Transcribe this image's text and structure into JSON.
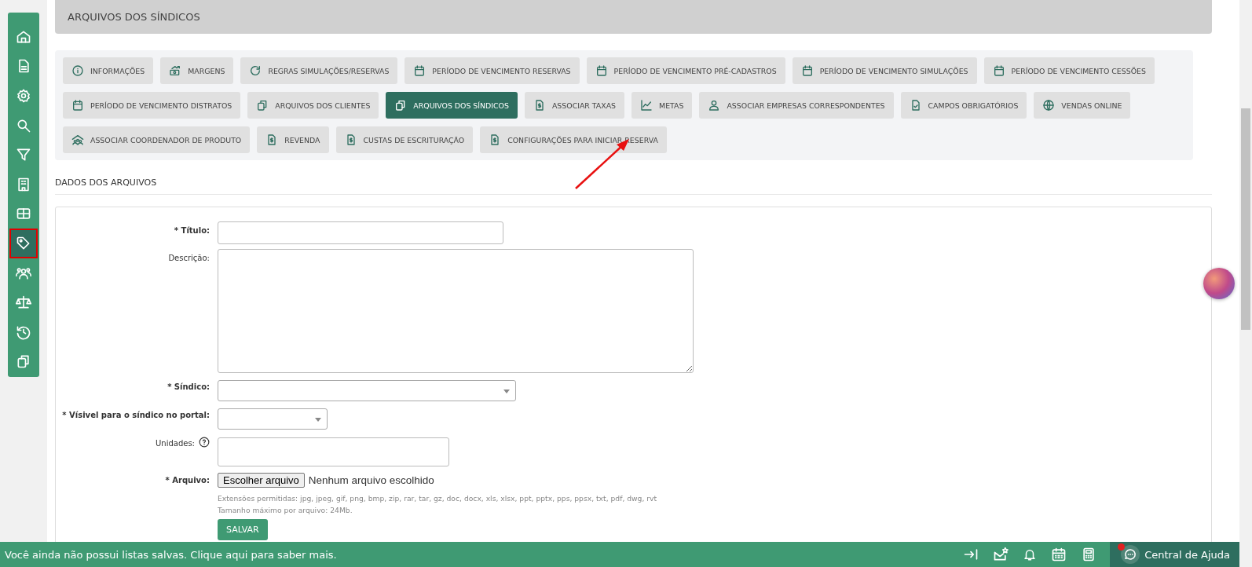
{
  "header": {
    "title": "ARQUIVOS DOS SÍNDICOS"
  },
  "sidebar": {
    "items": [
      {
        "selected": false
      },
      {
        "selected": false
      },
      {
        "selected": false
      },
      {
        "selected": false
      },
      {
        "selected": false
      },
      {
        "selected": false
      },
      {
        "selected": false
      },
      {
        "selected": true
      },
      {
        "selected": false
      },
      {
        "selected": false
      },
      {
        "selected": false
      },
      {
        "selected": false
      }
    ]
  },
  "tabs": [
    {
      "label": "INFORMAÇÕES",
      "selected": false
    },
    {
      "label": "MARGENS",
      "selected": false
    },
    {
      "label": "REGRAS SIMULAÇÕES/RESERVAS",
      "selected": false
    },
    {
      "label": "PERÍODO DE VENCIMENTO RESERVAS",
      "selected": false
    },
    {
      "label": "PERÍODO DE VENCIMENTO PRÉ-CADASTROS",
      "selected": false
    },
    {
      "label": "PERÍODO DE VENCIMENTO SIMULAÇÕES",
      "selected": false
    },
    {
      "label": "PERÍODO DE VENCIMENTO CESSÕES",
      "selected": false
    },
    {
      "label": "PERÍODO DE VENCIMENTO DISTRATOS",
      "selected": false
    },
    {
      "label": "ARQUIVOS DOS CLIENTES",
      "selected": false
    },
    {
      "label": "ARQUIVOS DOS SÍNDICOS",
      "selected": true
    },
    {
      "label": "ASSOCIAR TAXAS",
      "selected": false
    },
    {
      "label": "METAS",
      "selected": false
    },
    {
      "label": "ASSOCIAR EMPRESAS CORRESPONDENTES",
      "selected": false
    },
    {
      "label": "CAMPOS OBRIGATÓRIOS",
      "selected": false
    },
    {
      "label": "VENDAS ONLINE",
      "selected": false
    },
    {
      "label": "ASSOCIAR COORDENADOR DE PRODUTO",
      "selected": false
    },
    {
      "label": "REVENDA",
      "selected": false
    },
    {
      "label": "CUSTAS DE ESCRITURAÇÃO",
      "selected": false
    },
    {
      "label": "CONFIGURAÇÕES PARA INICIAR RESERVA",
      "selected": false
    }
  ],
  "section_title": "DADOS DOS ARQUIVOS",
  "form": {
    "fields": [
      {
        "kind": "text",
        "label": "* Título:",
        "required": true
      },
      {
        "kind": "textarea",
        "label": "Descrição:",
        "required": false
      },
      {
        "kind": "select",
        "label": "* Síndico:",
        "required": true
      },
      {
        "kind": "select-small",
        "label": "* Vísivel para o síndico no portal:",
        "required": true
      },
      {
        "kind": "help-text",
        "label": "Unidades:",
        "required": false
      },
      {
        "kind": "file",
        "label": "* Arquivo:",
        "required": true,
        "button": "Escolher arquivo",
        "status": "Nenhum arquivo escolhido"
      }
    ],
    "hints": [
      "Extensões permitidas: jpg, jpeg, gif, png, bmp, zip, rar, tar, gz, doc, docx, xls, xlsx, ppt, pptx, pps, ppsx, txt, pdf, dwg, rvt",
      "Tamanho máximo por arquivo: 24Mb."
    ],
    "submit": "SALVAR"
  },
  "bottom_bar": {
    "message": "Você ainda não possui listas salvas. Clique aqui para saber mais.",
    "help": "Central de Ajuda",
    "help_badge": true
  }
}
